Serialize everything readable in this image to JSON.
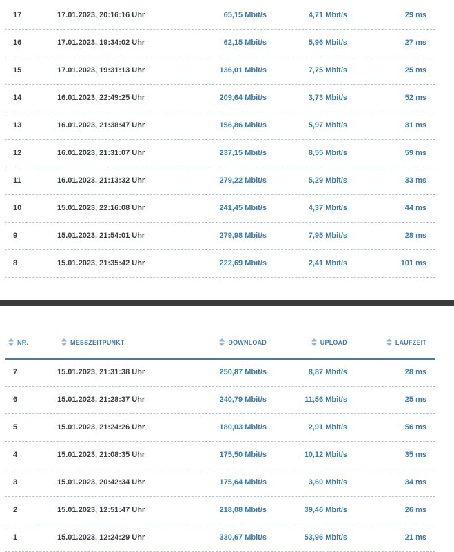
{
  "top_table": {
    "rows": [
      {
        "nr": "17",
        "time": "17.01.2023, 20:16:16 Uhr",
        "download": "65,15 Mbit/s",
        "upload": "4,71 Mbit/s",
        "ping": "29 ms"
      },
      {
        "nr": "16",
        "time": "17.01.2023, 19:34:02 Uhr",
        "download": "62,15 Mbit/s",
        "upload": "5,96 Mbit/s",
        "ping": "27 ms"
      },
      {
        "nr": "15",
        "time": "17.01.2023, 19:31:13 Uhr",
        "download": "136,01 Mbit/s",
        "upload": "7,75 Mbit/s",
        "ping": "25 ms"
      },
      {
        "nr": "14",
        "time": "16.01.2023, 22:49:25 Uhr",
        "download": "209,64 Mbit/s",
        "upload": "3,73 Mbit/s",
        "ping": "52 ms"
      },
      {
        "nr": "13",
        "time": "16.01.2023, 21:38:47 Uhr",
        "download": "156,86 Mbit/s",
        "upload": "5,97 Mbit/s",
        "ping": "31 ms"
      },
      {
        "nr": "12",
        "time": "16.01.2023, 21:31:07 Uhr",
        "download": "237,15 Mbit/s",
        "upload": "8,55 Mbit/s",
        "ping": "59 ms"
      },
      {
        "nr": "11",
        "time": "16.01.2023, 21:13:32 Uhr",
        "download": "279,22 Mbit/s",
        "upload": "5,29 Mbit/s",
        "ping": "33 ms"
      },
      {
        "nr": "10",
        "time": "15.01.2023, 22:16:08 Uhr",
        "download": "241,45 Mbit/s",
        "upload": "4,37 Mbit/s",
        "ping": "44 ms"
      },
      {
        "nr": "9",
        "time": "15.01.2023, 21:54:01 Uhr",
        "download": "279,98 Mbit/s",
        "upload": "7,95 Mbit/s",
        "ping": "28 ms"
      },
      {
        "nr": "8",
        "time": "15.01.2023, 21:35:42 Uhr",
        "download": "222,69 Mbit/s",
        "upload": "2,41 Mbit/s",
        "ping": "101 ms"
      }
    ]
  },
  "bottom_table": {
    "headers": {
      "nr": "NR.",
      "time": "MESSZEITPUNKT",
      "download": "DOWNLOAD",
      "upload": "UPLOAD",
      "ping": "LAUFZEIT"
    },
    "rows": [
      {
        "nr": "7",
        "time": "15.01.2023, 21:31:38 Uhr",
        "download": "250,87 Mbit/s",
        "upload": "8,87 Mbit/s",
        "ping": "28 ms"
      },
      {
        "nr": "6",
        "time": "15.01.2023, 21:28:37 Uhr",
        "download": "240,79 Mbit/s",
        "upload": "11,56 Mbit/s",
        "ping": "25 ms"
      },
      {
        "nr": "5",
        "time": "15.01.2023, 21:24:26 Uhr",
        "download": "180,03 Mbit/s",
        "upload": "2,91 Mbit/s",
        "ping": "56 ms"
      },
      {
        "nr": "4",
        "time": "15.01.2023, 21:08:35 Uhr",
        "download": "175,50 Mbit/s",
        "upload": "10,12 Mbit/s",
        "ping": "35 ms"
      },
      {
        "nr": "3",
        "time": "15.01.2023, 20:42:34 Uhr",
        "download": "175,64 Mbit/s",
        "upload": "3,60 Mbit/s",
        "ping": "34 ms"
      },
      {
        "nr": "2",
        "time": "15.01.2023, 12:51:47 Uhr",
        "download": "218,08 Mbit/s",
        "upload": "39,46 Mbit/s",
        "ping": "26 ms"
      },
      {
        "nr": "1",
        "time": "15.01.2023, 12:24:29 Uhr",
        "download": "330,67 Mbit/s",
        "upload": "53,96 Mbit/s",
        "ping": "21 ms"
      }
    ]
  },
  "colors": {
    "accent": "#3a7cab",
    "text": "#3a3f44",
    "header_rule": "#4a7a9d",
    "divider": "#3b3b3b"
  },
  "icons": {
    "sort": "sort-icon"
  }
}
